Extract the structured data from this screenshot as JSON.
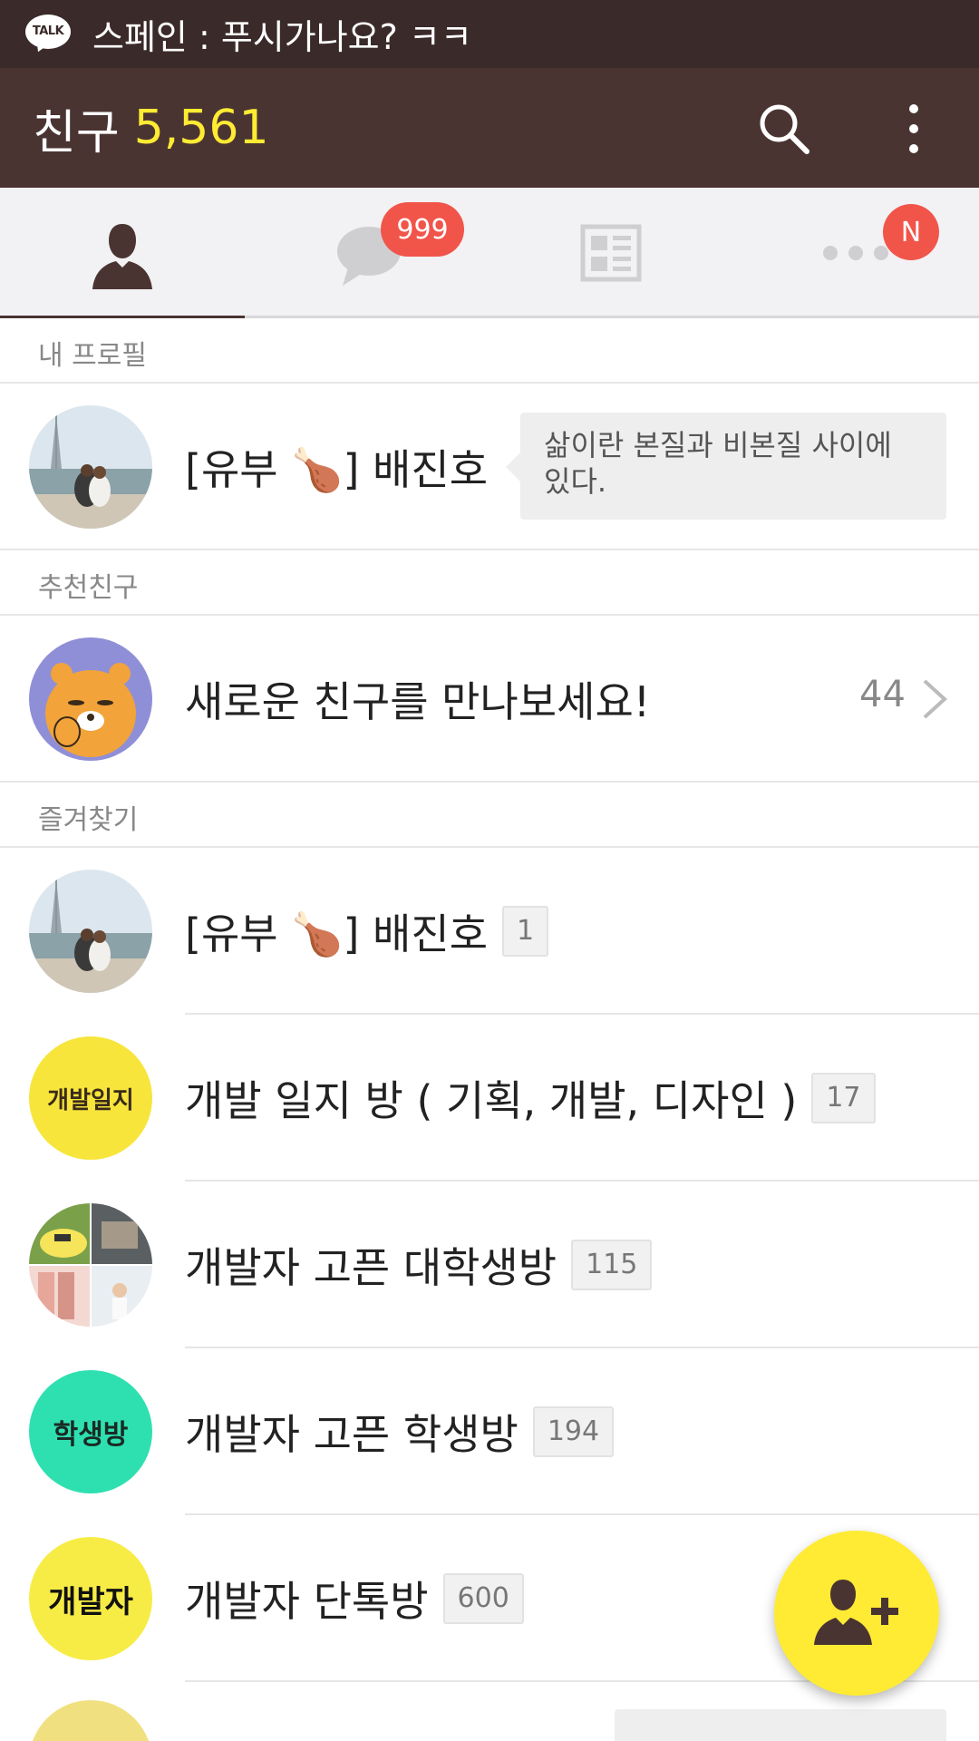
{
  "status_bar": {
    "app_icon_label": "TALK",
    "notification_text": "스페인 : 푸시가나요? ㅋㅋ"
  },
  "header": {
    "title": "친구",
    "friend_count": "5,561",
    "search_icon": "search-icon",
    "menu_icon": "more-vertical-icon"
  },
  "tabs": [
    {
      "name": "friends",
      "icon": "person-icon",
      "active": true
    },
    {
      "name": "chats",
      "icon": "chat-bubble-icon",
      "badge": "999"
    },
    {
      "name": "news",
      "icon": "news-icon"
    },
    {
      "name": "more",
      "icon": "more-horizontal-icon",
      "badge": "N"
    }
  ],
  "sections": {
    "my_profile": "내 프로필",
    "recommended": "추천친구",
    "favorites": "즐겨찾기"
  },
  "my_profile": {
    "name": "[유부 🍗] 배진호",
    "status_message": "삶이란 본질과 비본질 사이에 있다."
  },
  "recommended": {
    "text": "새로운 친구를 만나보세요!",
    "count": "44"
  },
  "favorites": [
    {
      "name": "[유부 🍗] 배진호",
      "count": "1"
    },
    {
      "name": "개발 일지 방 ( 기획, 개발, 디자인 )",
      "count": "17",
      "avatar_text": "개발일지",
      "avatar_color": "#f7e53b"
    },
    {
      "name": "개발자 고픈 대학생방",
      "count": "115"
    },
    {
      "name": "개발자 고픈 학생방",
      "count": "194",
      "avatar_text": "학생방",
      "avatar_color": "#2ee0b0"
    },
    {
      "name": "개발자 단톡방",
      "count": "600",
      "avatar_text": "개발자",
      "avatar_color": "#f7ec45"
    }
  ],
  "fab": {
    "icon": "add-friend-icon",
    "color": "#ffeb33"
  },
  "colors": {
    "header_bg": "#4a3432",
    "status_bg": "#3a2a29",
    "accent_yellow": "#ffeb33",
    "badge_red": "#f1554a"
  }
}
